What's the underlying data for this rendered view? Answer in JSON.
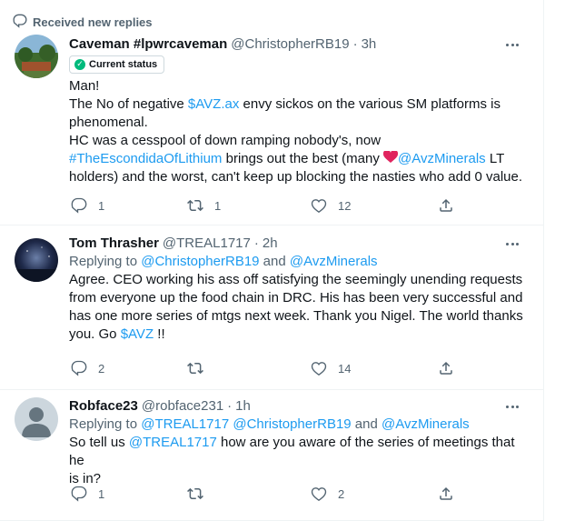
{
  "banner": {
    "text": "Received new replies"
  },
  "tweets": [
    {
      "name": "Caveman #lpwrcaveman",
      "handle": "@ChristopherRB19",
      "time": "3h",
      "status": "Current status",
      "text": {
        "l1": "Man!",
        "l2a": "The No of negative ",
        "cashtag": "$AVZ.ax",
        "l2b": " envy sickos on the various SM platforms is",
        "l3": "phenomenal.",
        "l4": "HC was a cesspool of  down ramping nobody's, now",
        "hashtag": "#TheEscondidaOfLithium",
        "l5b": " brings out the best (many ",
        "mention": "@AvzMinerals",
        "l5c": " LT",
        "l6": "holders) and the worst, can't keep up blocking the nasties who add 0 value."
      },
      "replies": "1",
      "retweets": "1",
      "likes": "12"
    },
    {
      "name": "Tom Thrasher",
      "handle": "@TREAL1717",
      "time": "2h",
      "replying_prefix": "Replying to ",
      "replying_to1": "@ChristopherRB19",
      "replying_and": " and ",
      "replying_to2": "@AvzMinerals",
      "text": {
        "l1": "Agree. CEO working his ass off satisfying the seemingly unending requests",
        "l2": "from everyone up the food chain in DRC. His has been very successful and",
        "l3": "has one more series of mtgs next week. Thank you Nigel. The world thanks",
        "l4a": "you. Go ",
        "cashtag": "$AVZ",
        "l4b": " !!"
      },
      "replies": "2",
      "retweets": "",
      "likes": "14"
    },
    {
      "name": "Robface23",
      "handle": "@robface231",
      "time": "1h",
      "replying_prefix": "Replying to ",
      "replying_to1": "@TREAL1717",
      "replying_sep": " ",
      "replying_to2": "@ChristopherRB19",
      "replying_and": " and ",
      "replying_to3": "@AvzMinerals",
      "text": {
        "l1a": "So tell us ",
        "mention": "@TREAL1717",
        "l1b": " how are you aware of the series of meetings that he",
        "l2": "is in?"
      },
      "replies": "1",
      "retweets": "",
      "likes": "2"
    }
  ],
  "separator": "·",
  "colors": {
    "link": "#1d9bf0",
    "secondary": "#536471",
    "verified": "#00ba7c",
    "heart": "#e0245e"
  },
  "icons": [
    "reply-icon",
    "retweet-icon",
    "like-icon",
    "share-icon",
    "more-icon",
    "heart-icon",
    "check-icon"
  ]
}
